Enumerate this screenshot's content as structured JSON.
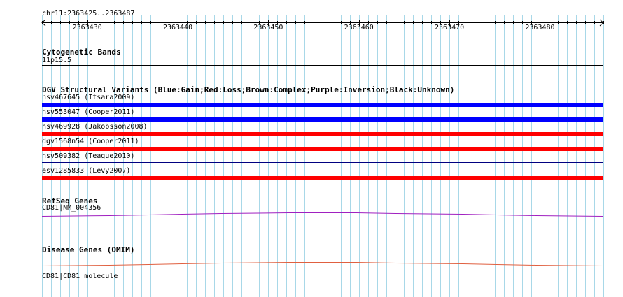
{
  "ruler": {
    "location": "chr11:2363425..2363487",
    "start": 2363425,
    "end": 2363487,
    "ticks": [
      "2363430",
      "2363440",
      "2363450",
      "2363460",
      "2363470",
      "2363480"
    ]
  },
  "tracks": {
    "cytoband": {
      "title": "Cytogenetic Bands",
      "band": "11p15.5"
    },
    "dgv": {
      "title": "DGV Structural Variants (Blue:Gain;Red:Loss;Brown:Complex;Purple:Inversion;Black:Unknown)",
      "variants": [
        {
          "label": "nsv467645 (Itsara2009)",
          "color": "#0000ff"
        },
        {
          "label": "nsv553047 (Cooper2011)",
          "color": "#0000ff"
        },
        {
          "label": "nsv469928 (Jakobsson2008)",
          "color": "#ff0000"
        },
        {
          "label": "dgv1568n54 (Cooper2011)",
          "color": "#ff0000"
        },
        {
          "label": "nsv509382 (Teague2010)",
          "color": "#000080"
        },
        {
          "label": "esv1285833 (Levy2007)",
          "color": "#ff0000"
        }
      ]
    },
    "refseq": {
      "title": "RefSeq Genes",
      "gene": "CD81|NM_004356",
      "color": "#a020c0"
    },
    "omim": {
      "title": "Disease Genes (OMIM)",
      "gene": "CD81|CD81 molecule",
      "color": "#e06040"
    }
  },
  "colors": {
    "grid": "#a8d8e8"
  }
}
